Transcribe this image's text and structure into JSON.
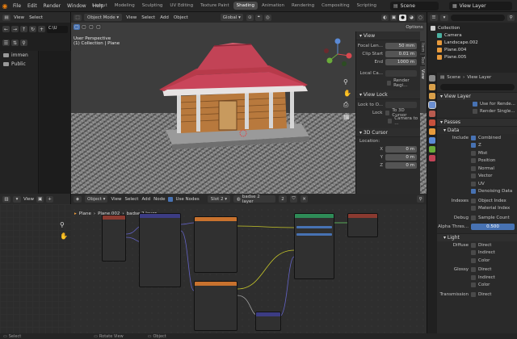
{
  "topbar": {
    "menus": [
      "File",
      "Edit",
      "Render",
      "Window",
      "Help"
    ],
    "workspaces": [
      "Layout",
      "Modeling",
      "Sculpting",
      "UV Editing",
      "Texture Paint",
      "Shading",
      "Animation",
      "Rendering",
      "Compositing",
      "Scripting"
    ],
    "active_workspace": "Shading",
    "scene": "Scene",
    "view_layer": "View Layer"
  },
  "filebrowser": {
    "menus": [
      "View",
      "Select"
    ],
    "path": "C:\\U",
    "places": [
      "immen",
      "Public"
    ]
  },
  "viewport": {
    "mode": "Object Mode",
    "menus": [
      "View",
      "Select",
      "Add",
      "Object"
    ],
    "orientation": "Global",
    "perspective": "User Perspective",
    "collection_line": "(1) Collection | Plane",
    "options": "Options"
  },
  "npanel": {
    "view_title": "View",
    "focal_length_label": "Focal Len...",
    "focal_length": "50 mm",
    "clip_start_label": "Clip Start",
    "clip_start": "0.01 m",
    "clip_end_label": "End",
    "clip_end": "1000 m",
    "local_camera_label": "Local Ca...",
    "render_region": "Render Regi...",
    "view_lock_title": "View Lock",
    "lock_to_object": "Lock to O...",
    "lock_label": "Lock",
    "to_3d_cursor": "To 3D Cursor",
    "camera_to": "Camera to ...",
    "cursor_title": "3D Cursor",
    "location_label": "Location:",
    "x_label": "X",
    "x": "0 m",
    "y_label": "Y",
    "y": "0 m",
    "z_label": "Z",
    "z": "0 m",
    "tabs": [
      "Item",
      "Tool",
      "View"
    ]
  },
  "outliner": {
    "items": [
      {
        "name": "Collection",
        "color": "#cfcfcf"
      },
      {
        "name": "Camera",
        "color": "#4bb0a0"
      },
      {
        "name": "Landscape.002",
        "color": "#e89a3c"
      },
      {
        "name": "Plane.004",
        "color": "#e89a3c"
      },
      {
        "name": "Plane.005",
        "color": "#e89a3c"
      }
    ]
  },
  "properties": {
    "scene": "Scene",
    "view_layer": "View Layer",
    "view_layer_section": "View Layer",
    "use_for_render": "Use for Rende...",
    "render_single": "Render Single...",
    "passes": "Passes",
    "data": "Data",
    "include_label": "Include",
    "include": [
      {
        "name": "Combined",
        "on": true
      },
      {
        "name": "Z",
        "on": true
      },
      {
        "name": "Mist",
        "on": false
      },
      {
        "name": "Position",
        "on": false
      },
      {
        "name": "Normal",
        "on": false
      },
      {
        "name": "Vector",
        "on": false
      },
      {
        "name": "UV",
        "on": false
      },
      {
        "name": "Denoising Data",
        "on": true
      }
    ],
    "indexes_label": "Indexes",
    "object_index": "Object Index",
    "material_index": "Material Index",
    "debug_label": "Debug",
    "sample_count": "Sample Count",
    "alpha_threshold_label": "Alpha Thres...",
    "alpha_threshold": "0.500",
    "light": "Light",
    "diffuse_label": "Diffuse",
    "glossy_label": "Glossy",
    "transmission_label": "Transmission",
    "direct": "Direct",
    "indirect": "Indirect",
    "color": "Color"
  },
  "imgeditor": {
    "menus": [
      "View"
    ]
  },
  "nodeeditor": {
    "object_label": "Object",
    "menus": [
      "View",
      "Select",
      "Add",
      "Node"
    ],
    "use_nodes": "Use Nodes",
    "slot": "Slot 2",
    "material": "badse 2 layer",
    "users": "2",
    "breadcrumb_object": "Plane",
    "breadcrumb_mesh": "Plane.002",
    "breadcrumb_material": "badse 2 layer"
  },
  "statusbar": {
    "items": [
      "Select",
      "Rotate View",
      "Object"
    ]
  }
}
